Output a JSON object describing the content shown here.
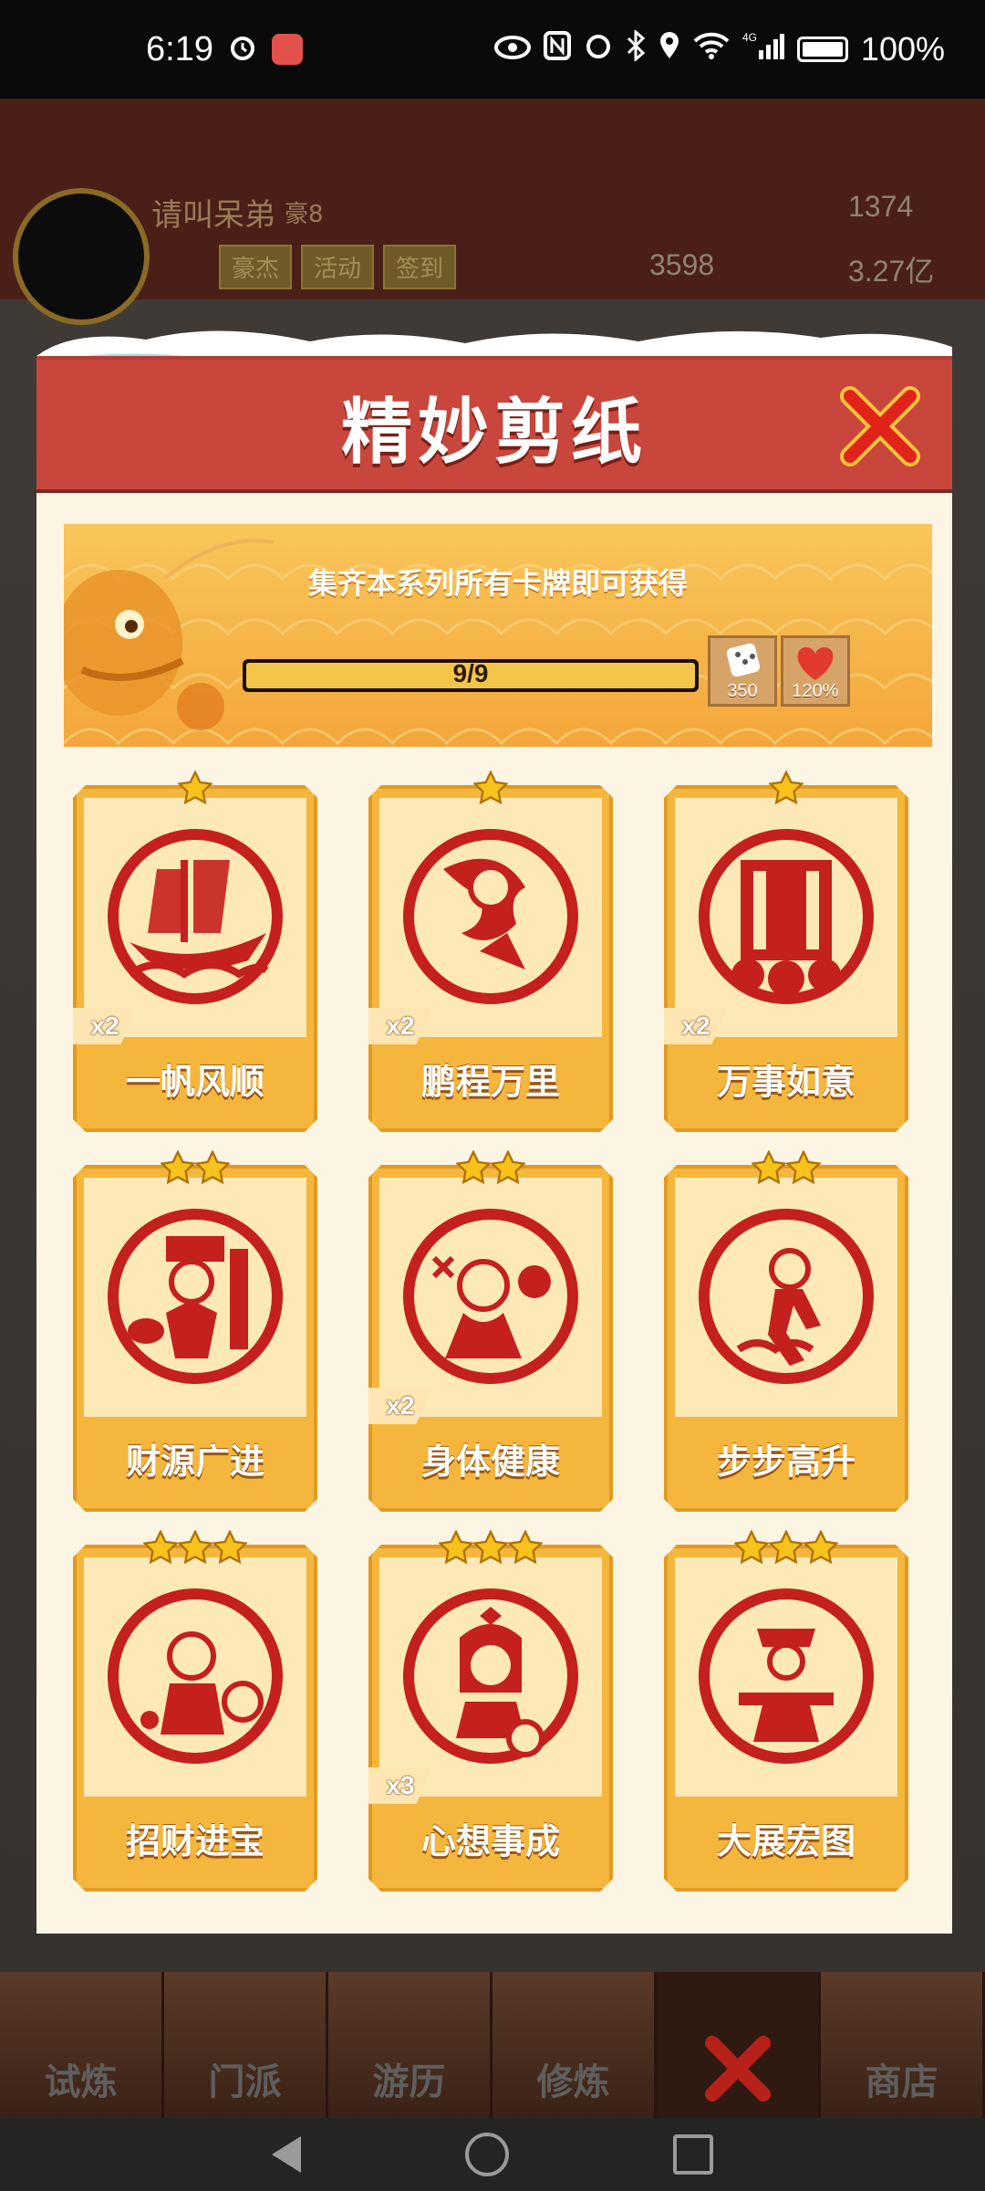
{
  "status_bar": {
    "time": "6:19",
    "network": "4G",
    "battery_percent": "100%"
  },
  "header": {
    "player_name": "请叫呆弟",
    "rank": "豪8",
    "buttons": [
      "豪杰",
      "活动",
      "签到"
    ],
    "gems": "1374",
    "tokens": "3598",
    "coins": "3.27亿"
  },
  "modal": {
    "title": "精妙剪纸",
    "banner_text": "集齐本系列所有卡牌即可获得",
    "progress": {
      "collected": 9,
      "total": 9,
      "label": "9/9"
    },
    "rewards": [
      {
        "icon": "dice-icon",
        "value": "350"
      },
      {
        "icon": "heart-icon",
        "value": "120%"
      }
    ],
    "cards": [
      {
        "name": "一帆风顺",
        "stars": 1,
        "count": "x2"
      },
      {
        "name": "鹏程万里",
        "stars": 1,
        "count": "x2"
      },
      {
        "name": "万事如意",
        "stars": 1,
        "count": "x2"
      },
      {
        "name": "财源广进",
        "stars": 2,
        "count": ""
      },
      {
        "name": "身体健康",
        "stars": 2,
        "count": "x2"
      },
      {
        "name": "步步高升",
        "stars": 2,
        "count": ""
      },
      {
        "name": "招财进宝",
        "stars": 3,
        "count": ""
      },
      {
        "name": "心想事成",
        "stars": 3,
        "count": "x3"
      },
      {
        "name": "大展宏图",
        "stars": 3,
        "count": ""
      }
    ]
  },
  "bottom_nav": [
    "试炼",
    "门派",
    "游历",
    "修炼",
    "",
    "商店"
  ],
  "colors": {
    "accent_red": "#c9463c",
    "card_gold": "#f4b63c",
    "papercut_red": "#c4201e"
  }
}
